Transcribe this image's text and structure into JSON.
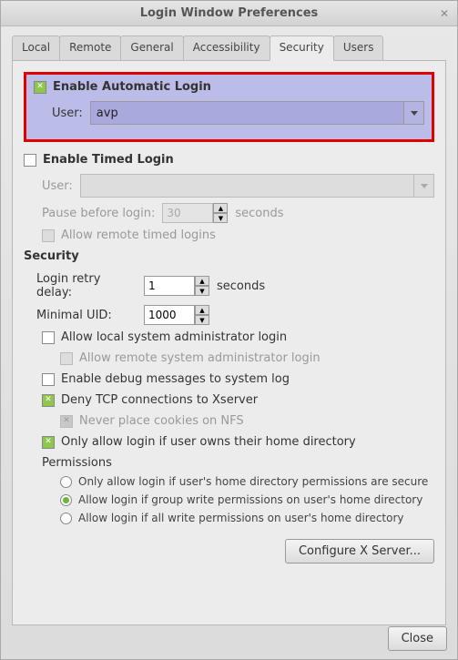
{
  "window": {
    "title": "Login Window Preferences"
  },
  "tabs": {
    "items": [
      "Local",
      "Remote",
      "General",
      "Accessibility",
      "Security",
      "Users"
    ],
    "active": 4
  },
  "auto_login": {
    "enable_label": "Enable Automatic Login",
    "user_label": "User:",
    "user_value": "avp"
  },
  "timed_login": {
    "enable_label": "Enable Timed Login",
    "user_label": "User:",
    "user_value": "",
    "pause_label": "Pause before login:",
    "pause_value": "30",
    "pause_unit": "seconds",
    "allow_remote_label": "Allow remote timed logins"
  },
  "security": {
    "heading": "Security",
    "retry_label": "Login retry delay:",
    "retry_value": "1",
    "retry_unit": "seconds",
    "uid_label": "Minimal UID:",
    "uid_value": "1000",
    "allow_local_admin": "Allow local system administrator login",
    "allow_remote_admin": "Allow remote system administrator login",
    "enable_debug": "Enable debug messages to system log",
    "deny_tcp": "Deny TCP connections to Xserver",
    "never_cookies": "Never place cookies on NFS",
    "only_owner": "Only allow login if user owns their home directory",
    "permissions_heading": "Permissions",
    "perm_secure": "Only allow login if user's home directory permissions are secure",
    "perm_group": "Allow login if group write permissions on user's home directory",
    "perm_all": "Allow login if all write permissions on user's home directory",
    "configure_btn": "Configure X Server..."
  },
  "footer": {
    "close": "Close"
  }
}
